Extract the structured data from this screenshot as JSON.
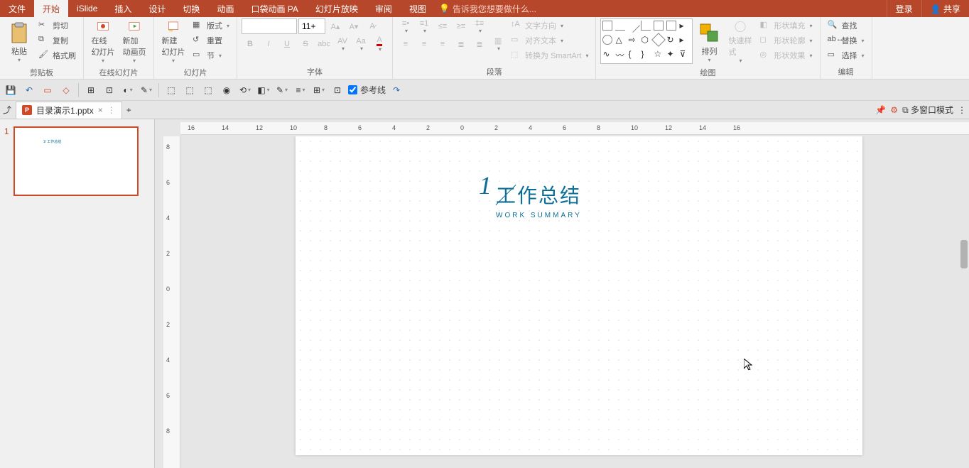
{
  "titlebar": {
    "tabs": [
      "文件",
      "开始",
      "iSlide",
      "插入",
      "设计",
      "切换",
      "动画",
      "口袋动画 PA",
      "幻灯片放映",
      "审阅",
      "视图"
    ],
    "active_index": 1,
    "tell_me": "告诉我您想要做什么...",
    "login": "登录",
    "share": "共享"
  },
  "ribbon": {
    "clipboard": {
      "paste": "粘贴",
      "cut": "剪切",
      "copy": "复制",
      "format_painter": "格式刷",
      "label": "剪贴板"
    },
    "online_slides": {
      "online": "在线\n幻灯片",
      "new_anim": "新加\n动画页",
      "label": "在线幻灯片"
    },
    "slides": {
      "new_slide": "新建\n幻灯片",
      "layout": "版式",
      "reset": "重置",
      "section": "节",
      "label": "幻灯片"
    },
    "font": {
      "size": "11+",
      "label": "字体"
    },
    "paragraph": {
      "text_direction": "文字方向",
      "align_text": "对齐文本",
      "convert_smartart": "转换为 SmartArt",
      "label": "段落"
    },
    "drawing": {
      "arrange": "排列",
      "quick_styles": "快速样式",
      "shape_fill": "形状填充",
      "shape_outline": "形状轮廓",
      "shape_effects": "形状效果",
      "label": "绘图"
    },
    "editing": {
      "find": "查找",
      "replace": "替换",
      "select": "选择",
      "label": "编辑"
    }
  },
  "qat": {
    "guides": "参考线"
  },
  "doctab": {
    "icon_left": "⤴",
    "filename": "目录演示1.pptx",
    "multi_window": "多窗口模式"
  },
  "thumbs": {
    "number": "1"
  },
  "slide": {
    "number": "1",
    "title_zh": "工作总结",
    "title_en": "WORK SUMMARY"
  },
  "ruler": {
    "h": [
      "16",
      "14",
      "12",
      "10",
      "8",
      "6",
      "4",
      "2",
      "0",
      "2",
      "4",
      "6",
      "8",
      "10",
      "12",
      "14",
      "16"
    ],
    "v": [
      "8",
      "6",
      "4",
      "2",
      "0",
      "2",
      "4",
      "6",
      "8"
    ]
  }
}
